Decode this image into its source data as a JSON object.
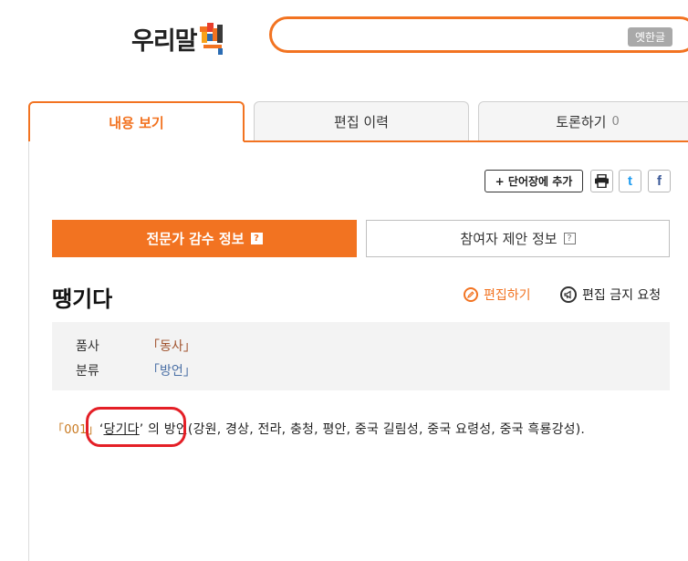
{
  "logo": {
    "text": "우리말"
  },
  "search": {
    "value": "",
    "old_hangul_label": "옛한글"
  },
  "main_tabs": [
    {
      "label": "내용 보기",
      "active": true
    },
    {
      "label": "편집 이력",
      "active": false
    },
    {
      "label": "토론하기",
      "count": "0",
      "active": false
    }
  ],
  "toolbar": {
    "add_wordbook_label": "+ 단어장에 추가",
    "twitter_glyph": "t",
    "facebook_glyph": "f"
  },
  "sub_tabs": [
    {
      "label": "전문가 감수 정보",
      "help": "?",
      "active": true
    },
    {
      "label": "참여자 제안 정보",
      "help": "?",
      "active": false
    }
  ],
  "entry": {
    "headword": "땡기다",
    "edit_label": "편집하기",
    "ban_label": "편집 금지 요청",
    "pos_label": "품사",
    "pos_value": "「동사」",
    "category_label": "분류",
    "category_value": "「방언」",
    "sense_number": "「001」",
    "ref_open": "‘",
    "ref_word": "당기다",
    "ref_close": "’",
    "definition_rest": "의 방언(강원, 경상, 전라, 충청, 평안, 중국 길림성, 중국 요령성, 중국 흑룡강성)."
  },
  "colors": {
    "accent": "#f27321",
    "highlight": "#e41f26"
  }
}
